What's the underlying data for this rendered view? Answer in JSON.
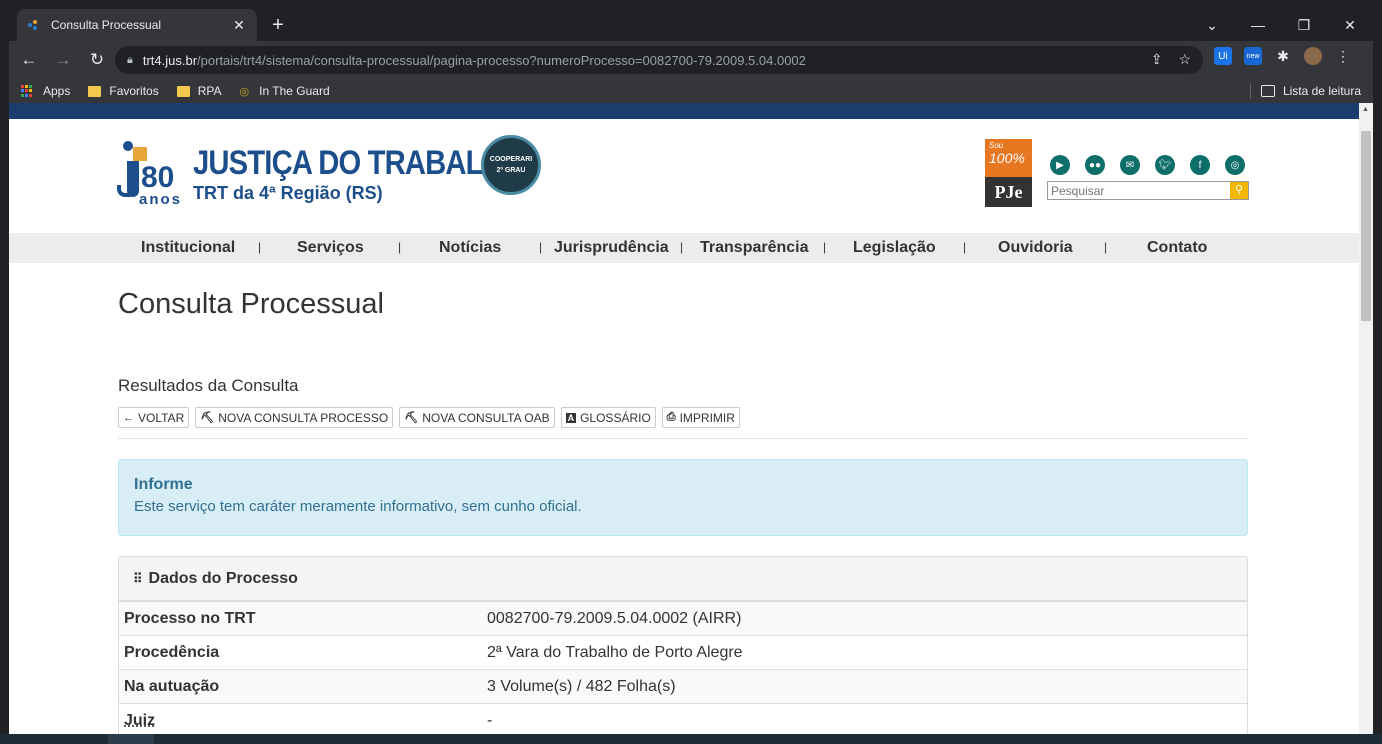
{
  "browser": {
    "tab_title": "Consulta Processual",
    "tab_close": "✕",
    "new_tab": "+",
    "url_host": "trt4.jus.br",
    "url_path": "/portais/trt4/sistema/consulta-processual/pagina-processo?numeroProcesso=0082700-79.2009.5.04.0002",
    "bookmarks": [
      "Apps",
      "Favoritos",
      "RPA",
      "In The Guard"
    ],
    "reading_list": "Lista de leitura",
    "ext_badge": "new"
  },
  "header": {
    "logo_number": "80",
    "logo_anos": "anos",
    "title": "JUSTIÇA DO TRABALHO",
    "subtitle": "TRT da 4ª Região (RS)",
    "seal_line1": "COOPERARI",
    "seal_line2": "2º GRAU",
    "pje_top1": "Sou",
    "pje_top2": "100%",
    "pje_bottom": "PJe",
    "search_placeholder": "Pesquisar"
  },
  "menu": [
    "Institucional",
    "Serviços",
    "Notícias",
    "Jurisprudência",
    "Transparência",
    "Legislação",
    "Ouvidoria",
    "Contato"
  ],
  "page": {
    "title": "Consulta Processual",
    "results_title": "Resultados da Consulta",
    "buttons": [
      {
        "label": "VOLTAR",
        "icon": "←"
      },
      {
        "label": "NOVA CONSULTA PROCESSO",
        "icon": "⛏"
      },
      {
        "label": "NOVA CONSULTA OAB",
        "icon": "⛏"
      },
      {
        "label": "GLOSSÁRIO",
        "icon": "A"
      },
      {
        "label": "IMPRIMIR",
        "icon": "⎙"
      }
    ],
    "alert_title": "Informe",
    "alert_text": "Este serviço tem caráter meramente informativo, sem cunho oficial.",
    "panel_title": "Dados do Processo",
    "rows": [
      {
        "key": "Processo no TRT",
        "value": "0082700-79.2009.5.04.0002 (AIRR)"
      },
      {
        "key": "Procedência",
        "value": "2ª Vara do Trabalho de Porto Alegre"
      },
      {
        "key": "Na autuação",
        "value": "3 Volume(s) / 482 Folha(s)"
      },
      {
        "key": "Juiz",
        "value": "-"
      }
    ]
  },
  "colors": {
    "brand_blue": "#1d4e8c",
    "alert_bg": "#d9edf7",
    "alert_text": "#31708f",
    "social_green": "#0e6e6a",
    "pje_orange": "#e87722"
  }
}
